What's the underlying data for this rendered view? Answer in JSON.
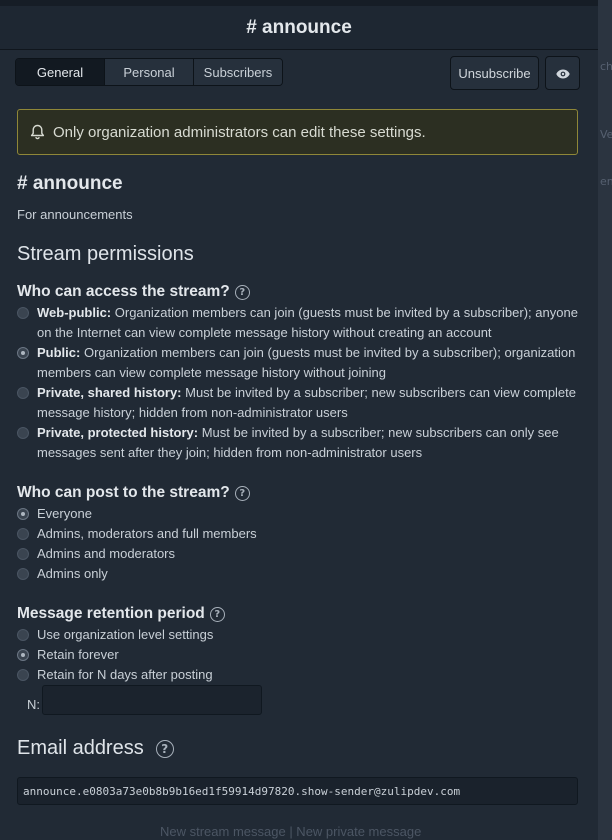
{
  "header": {
    "title": "# announce"
  },
  "tabs": [
    {
      "label": "General",
      "active": true
    },
    {
      "label": "Personal",
      "active": false
    },
    {
      "label": "Subscribers",
      "active": false
    }
  ],
  "actions": {
    "unsubscribe_label": "Unsubscribe",
    "view_icon": "eye-icon"
  },
  "alert": {
    "icon": "bell-icon",
    "text": "Only organization administrators can edit these settings."
  },
  "stream": {
    "name": "# announce",
    "description": "For announcements"
  },
  "permissions": {
    "title": "Stream permissions",
    "access": {
      "title": "Who can access the stream?",
      "options": [
        {
          "label": "Web-public:",
          "text": " Organization members can join (guests must be invited by a subscriber); anyone on the Internet can view complete message history without creating an account",
          "checked": false
        },
        {
          "label": "Public:",
          "text": " Organization members can join (guests must be invited by a subscriber); organization members can view complete message history without joining",
          "checked": true
        },
        {
          "label": "Private, shared history:",
          "text": " Must be invited by a subscriber; new subscribers can view complete message history; hidden from non-administrator users",
          "checked": false
        },
        {
          "label": "Private, protected history:",
          "text": " Must be invited by a subscriber; new subscribers can only see messages sent after they join; hidden from non-administrator users",
          "checked": false
        }
      ]
    },
    "post": {
      "title": "Who can post to the stream?",
      "options": [
        {
          "label": "Everyone",
          "checked": true
        },
        {
          "label": "Admins, moderators and full members",
          "checked": false
        },
        {
          "label": "Admins and moderators",
          "checked": false
        },
        {
          "label": "Admins only",
          "checked": false
        }
      ]
    },
    "retention": {
      "title": "Message retention period",
      "options": [
        {
          "label": "Use organization level settings",
          "checked": false
        },
        {
          "label": "Retain forever",
          "checked": true
        },
        {
          "label": "Retain for N days after posting",
          "checked": false
        }
      ],
      "n_label": "N:",
      "n_value": ""
    }
  },
  "email": {
    "title": "Email address",
    "address": "announce.e0803a73e0b8b9b16ed1f59914d97820.show-sender@zulipdev.com"
  },
  "background": {
    "footer_text": "New stream message   |   New private message",
    "side_snippets": [
      "cht",
      "Ve",
      "en"
    ]
  }
}
